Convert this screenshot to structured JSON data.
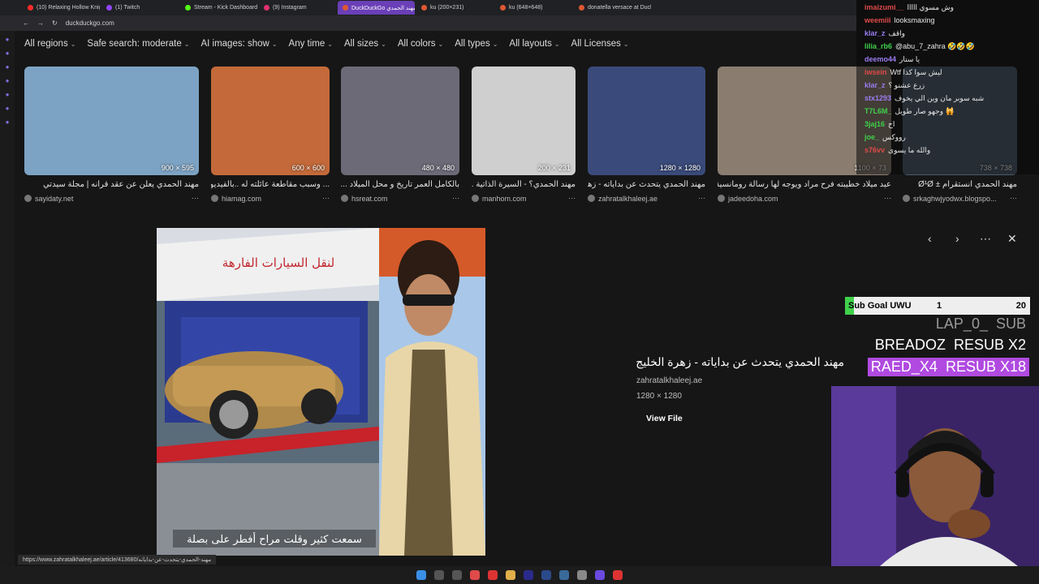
{
  "browser": {
    "tabs": [
      {
        "label": "(10) Relaxing Hollow Knig",
        "color": "#ff2a2a"
      },
      {
        "label": "(1) Twitch",
        "color": "#9146ff"
      },
      {
        "label": "Stream - Kick Dashboard",
        "color": "#53fc18"
      },
      {
        "label": "(9) Instagram",
        "color": "#e1306c"
      },
      {
        "label": "DuckDuckGo مهند الحمدي",
        "color": "#de5833",
        "active": true
      },
      {
        "label": "ku (200×231)",
        "color": "#de5833"
      },
      {
        "label": "ku (648×648)",
        "color": "#de5833"
      },
      {
        "label": "donatella versace at Duck",
        "color": "#de5833"
      }
    ],
    "url": "duckduckgo.com",
    "status_url": "https://www.zahratalkhaleej.ae/article/413680/مهند-الحمدي-يتحدث-عن-بداياته"
  },
  "filters": [
    "All regions",
    "Safe search: moderate",
    "AI images: show",
    "Any time",
    "All sizes",
    "All colors",
    "All types",
    "All layouts",
    "All Licenses"
  ],
  "results": [
    {
      "dim": "900 × 595",
      "title": "مهند الحمدي يعلن عن عقد قرانه | مجلة سيدتي",
      "source": "sayidaty.net",
      "bg": "#7da3c4"
    },
    {
      "dim": "600 × 600",
      "title": "... وسبب مقاطعة عائلته له ..بالفيديو",
      "source": "hiamag.com",
      "bg": "#c46a3a"
    },
    {
      "dim": "480 × 480",
      "title": "بالكامل العمر تاريخ و محل الميلاد ...",
      "source": "hsreat.com",
      "bg": "#6d6a78"
    },
    {
      "dim": "200 × 231",
      "title": "مهند الحمدي؟ - السيرة الذاتية ...",
      "source": "manhom.com",
      "bg": "#cfcfcf"
    },
    {
      "dim": "1280 × 1280",
      "title": "مهند الحمدي يتحدث عن بداياته - زهرة الخليج",
      "source": "zahratalkhaleej.ae",
      "bg": "#3a4a7a"
    },
    {
      "dim": "1100 × 73",
      "title": "عيد ميلاد خطيبته فرح مراد ويوجه لها رسالة رومانسية",
      "source": "jadeedoha.com",
      "bg": "#8a7d70"
    },
    {
      "dim": "738 × 738",
      "title": "مهند الحمدي انستقرام ± Ø¹Ø",
      "source": "srkaghwjyodwx.blogspo...",
      "bg": "#4a5a6a"
    }
  ],
  "detail": {
    "title": "مهند الحمدي يتحدث عن بداياته - زهرة الخليج",
    "site": "zahratalkhaleej.ae",
    "size": "1280 × 1280",
    "view_file": "View File",
    "caption": "سمعت كثير وقلت مراح أفطر على بصلة",
    "sign_text": "لنقل السيارات الفارهة"
  },
  "chat": [
    {
      "user": "imaizumi__",
      "color": "#e04a4a",
      "text": "وش مسوي ااااا"
    },
    {
      "user": "weemiii",
      "color": "#e04a4a",
      "text": "looksmaxing"
    },
    {
      "user": "klar_z",
      "color": "#9a7cf0",
      "text": "واقف"
    },
    {
      "user": "lilia_rb6",
      "color": "#3fd14a",
      "text": "@abu_7_zahra 🤣🤣🤣"
    },
    {
      "user": "deemo44",
      "color": "#9a7cf0",
      "text": "يا ستار"
    },
    {
      "user": "iwsein",
      "color": "#e04a4a",
      "text": "Wtf ليش سوا كذا"
    },
    {
      "user": "klar_z",
      "color": "#9a7cf0",
      "text": "زرع عشنو ؟"
    },
    {
      "user": "stx1293",
      "color": "#9a7cf0",
      "text": "شبه سوبر مان وين الي يخوف"
    },
    {
      "user": "T7L6M_",
      "color": "#3fd14a",
      "text": "وجهو صار طويل 🙀"
    },
    {
      "user": "3jaj16",
      "color": "#3fd14a",
      "text": "اح"
    },
    {
      "user": "joe_",
      "color": "#3fd14a",
      "text": "رووكس"
    },
    {
      "user": "s76vv",
      "color": "#e04a4a",
      "text": "والله ما يسوى"
    }
  ],
  "overlay": {
    "sub_goal_label": "Sub Goal UWU",
    "sub_goal_current": "1",
    "sub_goal_max": "20",
    "sub_goal_progress": 0.05,
    "ticker": [
      {
        "name": "LAP_0_",
        "action": "SUB",
        "style": "faded"
      },
      {
        "name": "BREADOZ",
        "action": "RESUB X2",
        "style": "plain"
      },
      {
        "name": "RAED_X4",
        "action": "RESUB X18",
        "style": "highlight"
      }
    ]
  },
  "colors": {
    "accent": "#6a3fb7",
    "highlight": "#b04ae0",
    "goal_green": "#3fd14a"
  }
}
